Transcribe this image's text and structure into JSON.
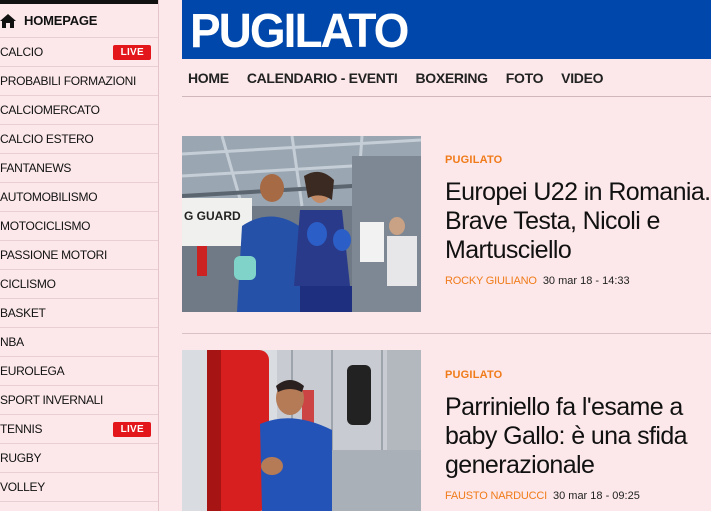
{
  "sidebar": {
    "home_label": "HOMEPAGE",
    "items": [
      {
        "label": "CALCIO",
        "badge": "LIVE"
      },
      {
        "label": "PROBABILI FORMAZIONI",
        "badge": ""
      },
      {
        "label": "CALCIOMERCATO",
        "badge": ""
      },
      {
        "label": "CALCIO ESTERO",
        "badge": ""
      },
      {
        "label": "FANTANEWS",
        "badge": ""
      },
      {
        "label": "AUTOMOBILISMO",
        "badge": ""
      },
      {
        "label": "MOTOCICLISMO",
        "badge": ""
      },
      {
        "label": "PASSIONE MOTORI",
        "badge": ""
      },
      {
        "label": "CICLISMO",
        "badge": ""
      },
      {
        "label": "BASKET",
        "badge": ""
      },
      {
        "label": "NBA",
        "badge": ""
      },
      {
        "label": "EUROLEGA",
        "badge": ""
      },
      {
        "label": "SPORT INVERNALI",
        "badge": ""
      },
      {
        "label": "TENNIS",
        "badge": "LIVE"
      },
      {
        "label": "RUGBY",
        "badge": ""
      },
      {
        "label": "VOLLEY",
        "badge": ""
      }
    ]
  },
  "brand": {
    "title": "PUGILATO",
    "color": "#0047ab"
  },
  "nav": {
    "items": [
      "HOME",
      "CALENDARIO - EVENTI",
      "BOXERING",
      "FOTO",
      "VIDEO"
    ]
  },
  "articles": [
    {
      "kicker": "PUGILATO",
      "headline": "Europei U22 in Romania. Brave Testa, Nicoli e Martusciello",
      "author": "ROCKY GIULIANO",
      "date": "30 mar 18 - 14:33",
      "image_text": "G GUARD"
    },
    {
      "kicker": "PUGILATO",
      "headline": "Parriniello fa l'esame a baby Gallo: è una sfida generazionale",
      "author": "FAUSTO NARDUCCI",
      "date": "30 mar 18 - 09:25"
    }
  ],
  "colors": {
    "accent": "#f07b1a",
    "live": "#e3161b",
    "background": "#fce8ea"
  }
}
